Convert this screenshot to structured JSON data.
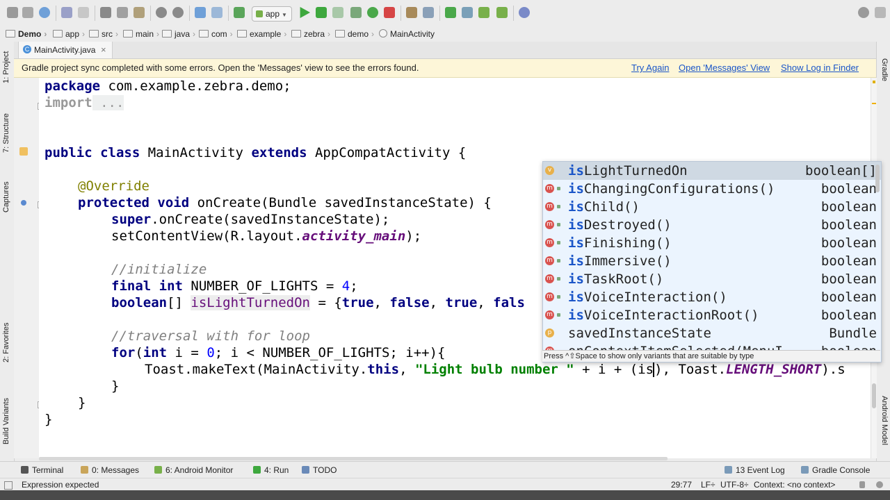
{
  "toolbar": {
    "run_config": "app"
  },
  "breadcrumb": [
    "Demo",
    "app",
    "src",
    "main",
    "java",
    "com",
    "example",
    "zebra",
    "demo",
    "MainActivity"
  ],
  "left_tools": [
    "1: Project",
    "7: Structure",
    "Captures",
    "2: Favorites",
    "Build Variants"
  ],
  "right_tools": [
    "Gradle",
    "Android Model"
  ],
  "tab": {
    "label": "MainActivity.java",
    "close": "×",
    "icon_letter": "C"
  },
  "banner": {
    "message": "Gradle project sync completed with some errors. Open the 'Messages' view to see the errors found.",
    "try_again": "Try Again",
    "open_messages": "Open 'Messages' View",
    "show_log": "Show Log in Finder"
  },
  "code": {
    "l1_kw": "package",
    "l1_rest": " com.example.zebra.demo;",
    "l2_kw": "import",
    "l2_rest": " ...",
    "l3_kw1": "public class",
    "l3_mid": " MainActivity ",
    "l3_kw2": "extends",
    "l3_rest": " AppCompatActivity {",
    "l4": "@Override",
    "l5_kw": "protected void",
    "l5_rest": " onCreate(Bundle savedInstanceState) {",
    "l6_kw": "super",
    "l6_rest": ".onCreate(savedInstanceState);",
    "l7_a": "setContentView(R.layout.",
    "l7_b": "activity_main",
    "l7_c": ");",
    "l8": "//initialize",
    "l9_kw": "final int",
    "l9_rest": " NUMBER_OF_LIGHTS = ",
    "l9_num": "4",
    "l9_end": ";",
    "l10_kw": "boolean",
    "l10_a": "[] ",
    "l10_var": "isLightTurnedOn",
    "l10_b": " = {",
    "l10_t1": "true",
    "l10_c": ", ",
    "l10_f1": "false",
    "l10_d": ", ",
    "l10_t2": "true",
    "l10_e": ", ",
    "l10_f2": "fals",
    "l11": "//traversal with for loop",
    "l12_kw1": "for",
    "l12_a": "(",
    "l12_kw2": "int",
    "l12_b": " i = ",
    "l12_num": "0",
    "l12_c": "; i < NUMBER_OF_LIGHTS; i++){",
    "l13_a": "Toast.makeText(MainActivity.",
    "l13_kw": "this",
    "l13_b": ", ",
    "l13_str": "\"Light bulb number \"",
    "l13_c": " + i + (is",
    "l13_d": "), Toast.",
    "l13_fd": "LENGTH_SHORT",
    "l13_e": ").s",
    "l14": "}",
    "l15": "}",
    "l16": "}"
  },
  "completion": {
    "items": [
      {
        "icon": "v",
        "icon_color": "#e8b04a",
        "prefix": "is",
        "rest": "LightTurnedOn",
        "type": "boolean[]",
        "selected": true
      },
      {
        "icon": "m",
        "icon_color": "#d9534f",
        "prefix": "is",
        "rest": "ChangingConfigurations()",
        "type": "boolean"
      },
      {
        "icon": "m",
        "icon_color": "#d9534f",
        "prefix": "is",
        "rest": "Child()",
        "type": "boolean"
      },
      {
        "icon": "m",
        "icon_color": "#d9534f",
        "prefix": "is",
        "rest": "Destroyed()",
        "type": "boolean"
      },
      {
        "icon": "m",
        "icon_color": "#d9534f",
        "prefix": "is",
        "rest": "Finishing()",
        "type": "boolean"
      },
      {
        "icon": "m",
        "icon_color": "#d9534f",
        "prefix": "is",
        "rest": "Immersive()",
        "type": "boolean"
      },
      {
        "icon": "m",
        "icon_color": "#d9534f",
        "prefix": "is",
        "rest": "TaskRoot()",
        "type": "boolean"
      },
      {
        "icon": "m",
        "icon_color": "#d9534f",
        "prefix": "is",
        "rest": "VoiceInteraction()",
        "type": "boolean"
      },
      {
        "icon": "m",
        "icon_color": "#d9534f",
        "prefix": "is",
        "rest": "VoiceInteractionRoot()",
        "type": "boolean"
      },
      {
        "icon": "p",
        "icon_color": "#e8b04a",
        "prefix": "",
        "rest": "savedInstanceState",
        "type": "Bundle"
      },
      {
        "icon": "m",
        "icon_color": "#d9534f",
        "prefix": "",
        "rest": "onContextItemSelected(MenuI",
        "type": "boolean"
      }
    ],
    "hint": "Press ^⇧Space to show only variants that are suitable by type"
  },
  "bottom_tools": [
    "Terminal",
    "0: Messages",
    "6: Android Monitor",
    "4: Run",
    "TODO",
    "13 Event Log",
    "Gradle Console"
  ],
  "status": {
    "message": "Expression expected",
    "position": "29:77",
    "line_sep": "LF÷",
    "encoding": "UTF-8÷",
    "context": "Context: <no context>"
  },
  "colors": {
    "accent_link": "#1a55c8",
    "banner_bg": "#fdf6d8",
    "keyword": "#000080"
  }
}
